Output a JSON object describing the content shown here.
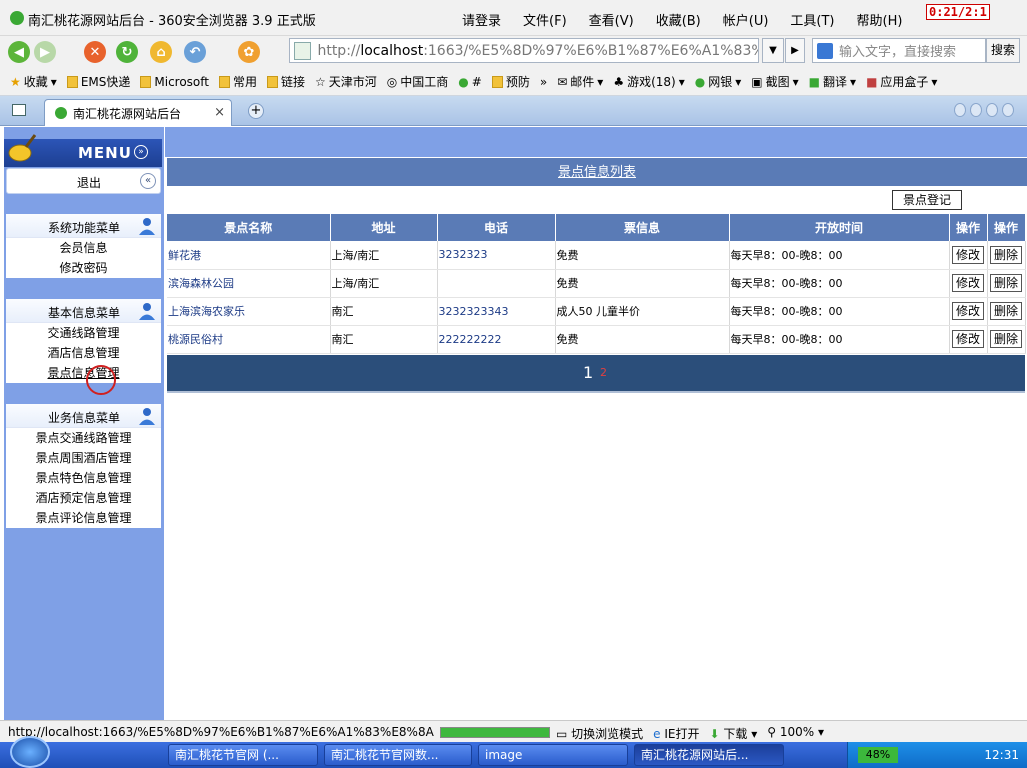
{
  "browser": {
    "window_title": "南汇桃花源网站后台 - 360安全浏览器 3.9 正式版",
    "menu": [
      "请登录",
      "文件(F)",
      "查看(V)",
      "收藏(B)",
      "帐户(U)",
      "工具(T)",
      "帮助(H)"
    ],
    "timer": "0:21/2:1",
    "url_prefix": "http://",
    "url_host": "localhost",
    "url_rest": ":1663/%E5%8D%97%E6%B1%87%E6%A1%83%E",
    "search_placeholder": "输入文字，直接搜索",
    "search_button": "搜索",
    "bookmarks": [
      "收藏",
      "EMS快递",
      "Microsoft",
      "常用",
      "链接",
      "天津市河",
      "中国工商",
      "#",
      "预防",
      "邮件",
      "游戏(18)",
      "网银",
      "截图",
      "翻译",
      "应用盒子"
    ],
    "bookmarks_more": "»",
    "tab_label": "南汇桃花源网站后台",
    "tab_close": "×",
    "new_tab": "+"
  },
  "sidebar": {
    "menu_title": "MENU",
    "logout": "退出",
    "collapse": "«",
    "expand": "»",
    "sections": [
      {
        "title": "系统功能菜单",
        "items": [
          "会员信息",
          "修改密码"
        ]
      },
      {
        "title": "基本信息菜单",
        "items": [
          "交通线路管理",
          "酒店信息管理",
          "景点信息管理"
        ]
      },
      {
        "title": "业务信息菜单",
        "items": [
          "景点交通线路管理",
          "景点周围酒店管理",
          "景点特色信息管理",
          "酒店预定信息管理",
          "景点评论信息管理"
        ]
      }
    ]
  },
  "main": {
    "list_title": "景点信息列表",
    "register_button": "景点登记",
    "columns": [
      "景点名称",
      "地址",
      "电话",
      "票信息",
      "开放时间",
      "操作",
      "操作"
    ],
    "rows": [
      {
        "name": "鲜花港",
        "address": "上海/南汇",
        "phone": "3232323",
        "ticket": "免费",
        "hours": "每天早8：00-晚8：00",
        "edit": "修改",
        "delete": "删除"
      },
      {
        "name": "滨海森林公园",
        "address": "上海/南汇",
        "phone": "",
        "ticket": "免费",
        "hours": "每天早8：00-晚8：00",
        "edit": "修改",
        "delete": "删除"
      },
      {
        "name": "上海滨海农家乐",
        "address": "南汇",
        "phone": "3232323343",
        "ticket": "成人50  儿童半价",
        "hours": "每天早8：00-晚8：00",
        "edit": "修改",
        "delete": "删除"
      },
      {
        "name": "桃源民俗村",
        "address": "南汇",
        "phone": "222222222",
        "ticket": "免费",
        "hours": "每天早8：00-晚8：00",
        "edit": "修改",
        "delete": "删除"
      }
    ],
    "pager": {
      "current": "1",
      "next": "2"
    }
  },
  "statusbar": {
    "url": "http://localhost:1663/%E5%8D%97%E6%B1%87%E6%A1%83%E8%8A%",
    "items": [
      "切换浏览模式",
      "IE打开",
      "下载",
      "100%"
    ]
  },
  "taskbar": {
    "tasks": [
      "南汇桃花节官网 (...",
      "南汇桃花节官网数...",
      "image",
      "南汇桃花源网站后..."
    ],
    "battery": "48%",
    "clock": "12:31"
  }
}
